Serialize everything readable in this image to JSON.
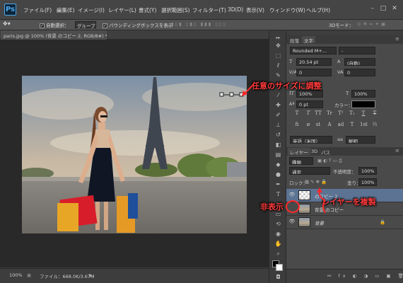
{
  "app": {
    "logo": "Ps"
  },
  "menu": [
    "ファイル(F)",
    "編集(E)",
    "イメージ(I)",
    "レイヤー(L)",
    "書式(Y)",
    "選択範囲(S)",
    "フィルター(T)",
    "3D(D)",
    "表示(V)",
    "ウィンドウ(W)",
    "ヘルプ(H)"
  ],
  "window_controls": {
    "minimize": "–",
    "maximize": "□",
    "close": "✕"
  },
  "options": {
    "auto_select_label": "自動選択：",
    "auto_select_value": "グループ",
    "bbox_label": "バウンディングボックスを表示",
    "mode_label": "3Dモード："
  },
  "document": {
    "tab_title": "paris.jpg @ 100% (背景 のコピー 2, RGB/8#) *",
    "close": "×"
  },
  "status": {
    "zoom": "100%",
    "file_info": "ファイル：668.0K/3.67M"
  },
  "char_panel": {
    "tabs": [
      "段落",
      "文字"
    ],
    "font_family": "Rounded M+...",
    "font_style": "-",
    "size": "20.54 pt",
    "leading": "(自動)",
    "kerning": "0",
    "tracking": "0",
    "vscale": "100%",
    "hscale": "100%",
    "baseline": "0 pt",
    "color_label": "カラー：",
    "color_value": "#000000",
    "type_buttons": [
      "T",
      "T",
      "TT",
      "Tr",
      "T¹",
      "T₁",
      "T",
      "T"
    ],
    "ot_buttons": [
      "fi",
      "ø",
      "st",
      "A",
      "ad",
      "T",
      "1st",
      "½"
    ],
    "language": "英語（米国）",
    "aa": "鮮明",
    "aa_prefix": "aa"
  },
  "layers_panel": {
    "tabs": [
      "レイヤー",
      "3D",
      "パス"
    ],
    "kind": "種類",
    "blend_mode": "通常",
    "opacity_label": "不透明度：",
    "opacity_value": "100%",
    "lock_label": "ロック：",
    "fill_label": "塗り：",
    "fill_value": "100%",
    "layers": [
      {
        "name": "のコピー 2",
        "visible": true,
        "selected": true
      },
      {
        "name": "背景 のコピー",
        "visible": false,
        "selected": false
      },
      {
        "name": "背景",
        "visible": true,
        "selected": false
      }
    ],
    "lock_icon": "🔒"
  },
  "annotations": {
    "resize": "任意のサイズに調整",
    "hide": "非表示",
    "duplicate": "レイヤーを複製"
  },
  "colors": {
    "accent": "#ff2a2a",
    "ps_blue": "#4aa8ee",
    "panel": "#4a4a4a",
    "selected_layer": "#5c7393"
  }
}
